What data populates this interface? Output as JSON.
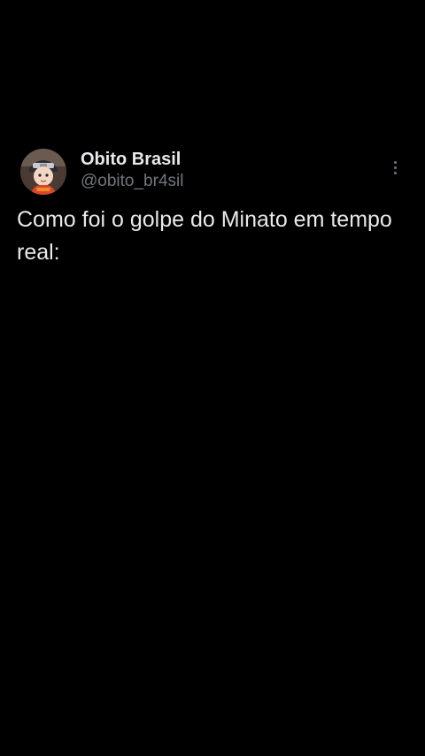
{
  "tweet": {
    "author": {
      "display_name": "Obito Brasil",
      "handle": "@obito_br4sil",
      "avatar_icon": "anime-character-avatar"
    },
    "more_icon": "more-vertical-icon",
    "text": "Como foi o golpe do Minato em tempo real:"
  },
  "colors": {
    "background": "#000000",
    "primary_text": "#e7e9ea",
    "secondary_text": "#71767b"
  }
}
